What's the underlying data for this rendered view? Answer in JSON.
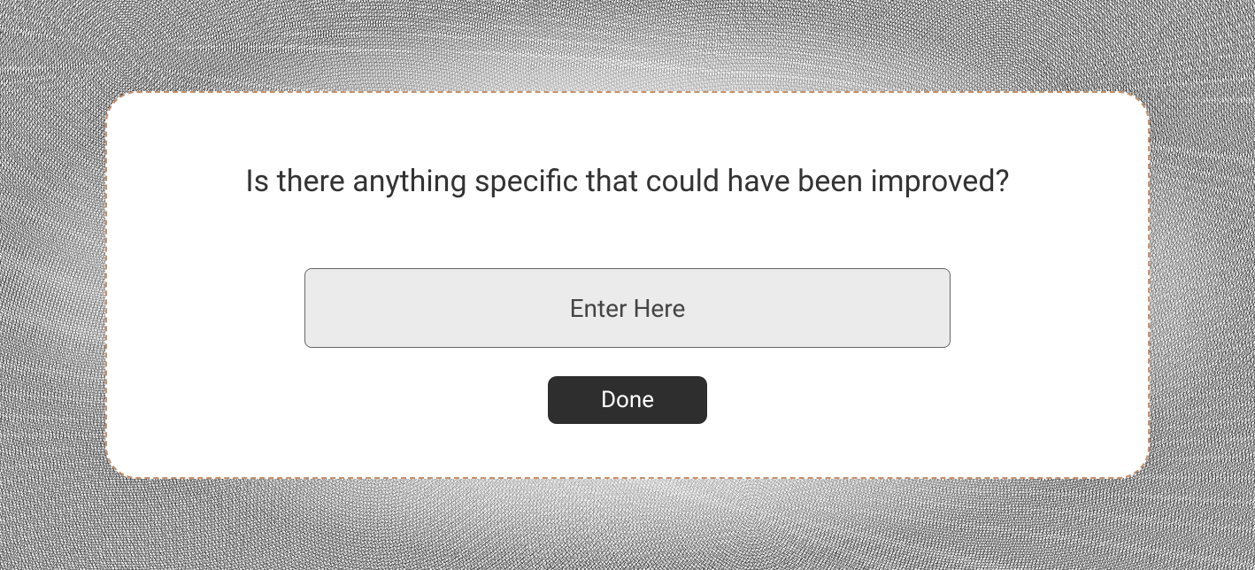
{
  "modal": {
    "prompt": "Is there anything specific that could have been improved?",
    "input": {
      "placeholder": "Enter Here",
      "value": ""
    },
    "done_label": "Done"
  },
  "colors": {
    "border": "#c7906a",
    "button_bg": "#2e2e2e",
    "input_bg": "#ebebeb"
  }
}
